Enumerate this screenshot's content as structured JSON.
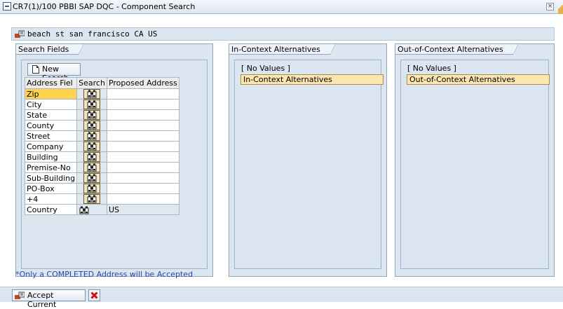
{
  "window": {
    "title": "CR7(1)/100 PBBI SAP DQC - Component Search",
    "close_label": "×"
  },
  "address": {
    "value": "beach st san francisco CA US"
  },
  "search_fields": {
    "tab": "Search Fields",
    "new_search": "New Search",
    "columns": [
      "Address Fiel",
      "Search",
      "Proposed Address"
    ],
    "rows": [
      {
        "field": "Zip",
        "value": ""
      },
      {
        "field": "City",
        "value": ""
      },
      {
        "field": "State",
        "value": ""
      },
      {
        "field": "County",
        "value": ""
      },
      {
        "field": "Street",
        "value": ""
      },
      {
        "field": "Company",
        "value": ""
      },
      {
        "field": "Building",
        "value": ""
      },
      {
        "field": "Premise-No",
        "value": ""
      },
      {
        "field": "Sub-Building",
        "value": ""
      },
      {
        "field": "PO-Box",
        "value": ""
      },
      {
        "field": "+4",
        "value": ""
      },
      {
        "field": "Country",
        "value": "US"
      }
    ]
  },
  "in_context": {
    "tab": "In-Context Alternatives",
    "no_values": "[ No Values ]",
    "item": "In-Context Alternatives"
  },
  "out_context": {
    "tab": "Out-of-Context Alternatives",
    "no_values": "[ No Values ]",
    "item": "Out-of-Context Alternatives"
  },
  "note": "*Only a COMPLETED Address will be Accepted",
  "bottom": {
    "accept": "Accept Current"
  },
  "colors": {
    "selection": "#ffd34d",
    "panel": "#dce6f0",
    "note_text": "#2a45a8",
    "cancel_icon": "#d01010"
  }
}
